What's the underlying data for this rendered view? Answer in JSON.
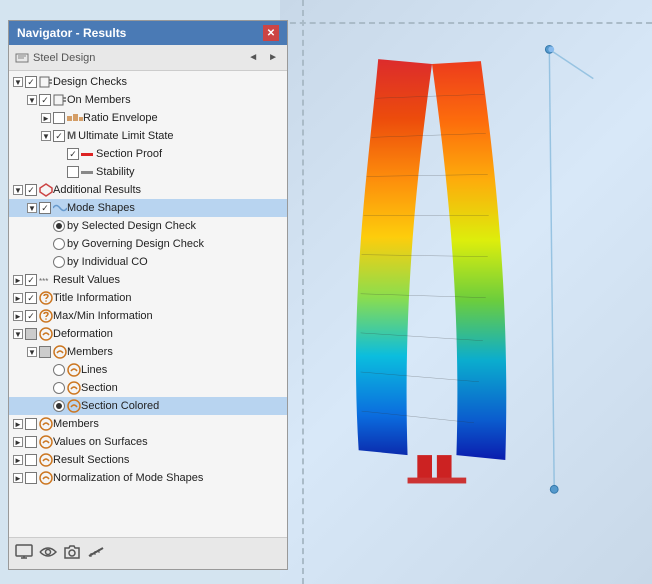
{
  "navigator": {
    "title": "Navigator - Results",
    "toolbar": {
      "label": "Steel Design",
      "prev_arrow": "◄",
      "next_arrow": "►"
    },
    "tree": [
      {
        "id": "design-checks",
        "label": "Design Checks",
        "level": 1,
        "expand": "▼",
        "checkbox": "partial",
        "icon": "checks"
      },
      {
        "id": "on-members",
        "label": "On Members",
        "level": 2,
        "expand": "▼",
        "checkbox": "partial",
        "icon": "member"
      },
      {
        "id": "ratio-envelope",
        "label": "Ratio Envelope",
        "level": 3,
        "expand": "►",
        "checkbox": "unchecked",
        "icon": "bar"
      },
      {
        "id": "ultimate-limit",
        "label": "Ultimate Limit State",
        "level": 3,
        "expand": "▼",
        "checkbox": "checked",
        "icon": "M"
      },
      {
        "id": "section-proof",
        "label": "Section Proof",
        "level": 4,
        "expand": "",
        "checkbox": "checked",
        "icon": "line-red"
      },
      {
        "id": "stability",
        "label": "Stability",
        "level": 4,
        "expand": "",
        "checkbox": "unchecked",
        "icon": "line-gray"
      },
      {
        "id": "additional-results",
        "label": "Additional Results",
        "level": 1,
        "expand": "▼",
        "checkbox": "checked",
        "icon": "flag"
      },
      {
        "id": "mode-shapes",
        "label": "Mode Shapes",
        "level": 2,
        "expand": "▼",
        "checkbox": "checked",
        "icon": "wave",
        "selected": true
      },
      {
        "id": "by-selected",
        "label": "by Selected Design Check",
        "level": 3,
        "expand": "",
        "radio": "checked"
      },
      {
        "id": "by-governing",
        "label": "by Governing Design Check",
        "level": 3,
        "expand": "",
        "radio": "unchecked"
      },
      {
        "id": "by-individual",
        "label": "by Individual CO",
        "level": 3,
        "expand": "",
        "radio": "unchecked"
      },
      {
        "id": "result-values",
        "label": "Result Values",
        "level": 1,
        "expand": "►",
        "checkbox": "checked",
        "icon": "xxx"
      },
      {
        "id": "title-info",
        "label": "Title Information",
        "level": 1,
        "expand": "►",
        "checkbox": "checked",
        "icon": "info"
      },
      {
        "id": "maxmin-info",
        "label": "Max/Min Information",
        "level": 1,
        "expand": "►",
        "checkbox": "checked",
        "icon": "info"
      },
      {
        "id": "deformation",
        "label": "Deformation",
        "level": 1,
        "expand": "▼",
        "checkbox": "partial",
        "icon": "deform"
      },
      {
        "id": "def-members",
        "label": "Members",
        "level": 2,
        "expand": "▼",
        "checkbox": "partial",
        "icon": "deform"
      },
      {
        "id": "lines",
        "label": "Lines",
        "level": 3,
        "expand": "",
        "radio": "unchecked",
        "icon": "deform"
      },
      {
        "id": "section",
        "label": "Section",
        "level": 3,
        "expand": "",
        "radio": "unchecked",
        "icon": "deform"
      },
      {
        "id": "section-colored",
        "label": "Section Colored",
        "level": 3,
        "expand": "",
        "radio": "checked",
        "icon": "deform",
        "selected": true
      },
      {
        "id": "members-top",
        "label": "Members",
        "level": 1,
        "expand": "►",
        "checkbox": "unchecked",
        "icon": "deform"
      },
      {
        "id": "values-on-surfaces",
        "label": "Values on Surfaces",
        "level": 1,
        "expand": "►",
        "checkbox": "unchecked",
        "icon": "surface"
      },
      {
        "id": "result-sections",
        "label": "Result Sections",
        "level": 1,
        "expand": "►",
        "checkbox": "unchecked",
        "icon": "section"
      },
      {
        "id": "normalization",
        "label": "Normalization of Mode Shapes",
        "level": 1,
        "expand": "►",
        "checkbox": "unchecked",
        "icon": "norm"
      }
    ],
    "footer_icons": [
      "display-icon",
      "eye-icon",
      "camera-icon",
      "line-icon"
    ]
  },
  "close_btn_label": "✕",
  "prev_arrow": "◄",
  "next_arrow": "►"
}
